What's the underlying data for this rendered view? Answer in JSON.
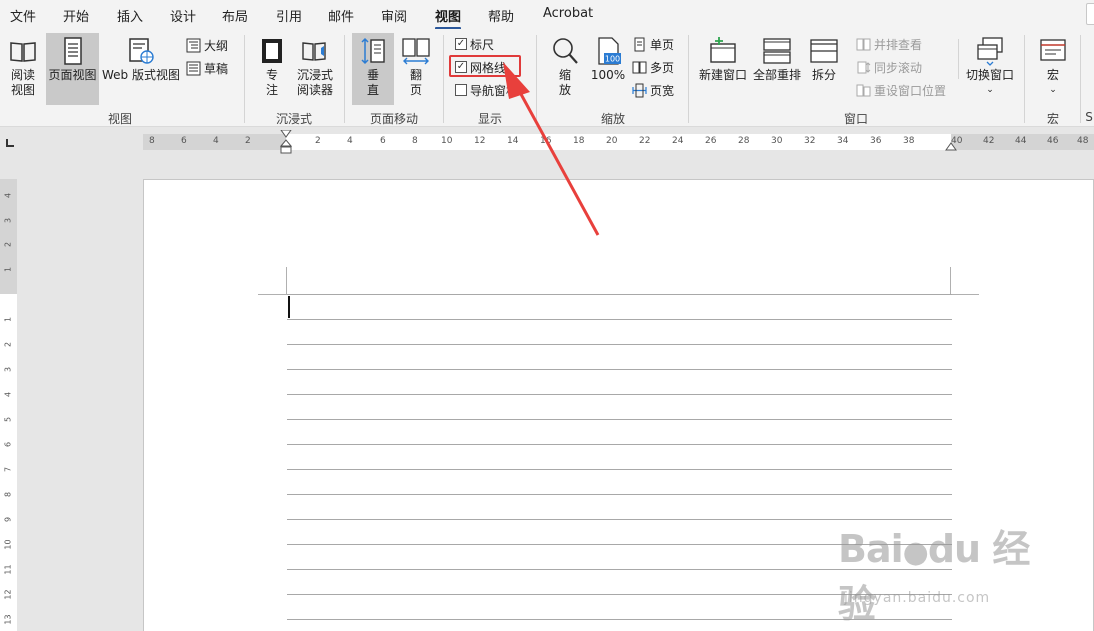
{
  "menu": {
    "tabs": [
      {
        "label": "文件"
      },
      {
        "label": "开始"
      },
      {
        "label": "插入"
      },
      {
        "label": "设计"
      },
      {
        "label": "布局"
      },
      {
        "label": "引用"
      },
      {
        "label": "邮件"
      },
      {
        "label": "审阅"
      },
      {
        "label": "视图"
      },
      {
        "label": "帮助"
      },
      {
        "label": "Acrobat"
      }
    ],
    "active": "视图"
  },
  "ribbon": {
    "view_group": {
      "label": "视图",
      "read_mode": "阅读\n视图",
      "print_layout": "页面视图",
      "web_layout": "Web 版式视图",
      "outline": "大纲",
      "draft": "草稿"
    },
    "immersive_group": {
      "label": "沉浸式",
      "focus": "专\n注",
      "immersive_reader": "沉浸式\n阅读器"
    },
    "page_movement_group": {
      "label": "页面移动",
      "vertical": "垂\n直",
      "side_to_side": "翻\n页"
    },
    "show_group": {
      "label": "显示",
      "ruler": {
        "label": "标尺",
        "checked": true
      },
      "gridlines": {
        "label": "网格线",
        "checked": true
      },
      "navigation": {
        "label": "导航窗格",
        "checked": false
      }
    },
    "zoom_group": {
      "label": "缩放",
      "zoom": "缩\n放",
      "hundred": "100%",
      "hundred_icon_text": "100",
      "one_page": "单页",
      "multi_page": "多页",
      "page_width": "页宽"
    },
    "window_group": {
      "label": "窗口",
      "new_window": "新建窗口",
      "arrange_all": "全部重排",
      "split": "拆分",
      "side_by_side": "并排查看",
      "sync_scroll": "同步滚动",
      "reset_position": "重设窗口位置",
      "switch_windows": "切换窗口"
    },
    "macros_group": {
      "label": "宏",
      "macros": "宏",
      "next_label": "S"
    }
  },
  "ruler": {
    "h_left": [
      "8",
      "6",
      "4",
      "2"
    ],
    "h_right": [
      "2",
      "4",
      "6",
      "8",
      "10",
      "12",
      "14",
      "16",
      "18",
      "20",
      "22",
      "24",
      "26",
      "28",
      "30",
      "32",
      "34",
      "36",
      "38",
      "40",
      "42",
      "44",
      "46",
      "48"
    ],
    "v_top": [
      "4",
      "3",
      "2",
      "1"
    ],
    "v_body": [
      "1",
      "2",
      "3",
      "4",
      "5",
      "6",
      "7",
      "8",
      "9",
      "10",
      "11",
      "12",
      "13"
    ]
  },
  "watermark": {
    "brand": "Bai",
    "brand2": "du",
    "cn": "经验",
    "url": "jingyan.baidu.com"
  },
  "colors": {
    "accent": "#2b579a",
    "highlight": "#e03a3a",
    "arrow": "#e8403c"
  }
}
